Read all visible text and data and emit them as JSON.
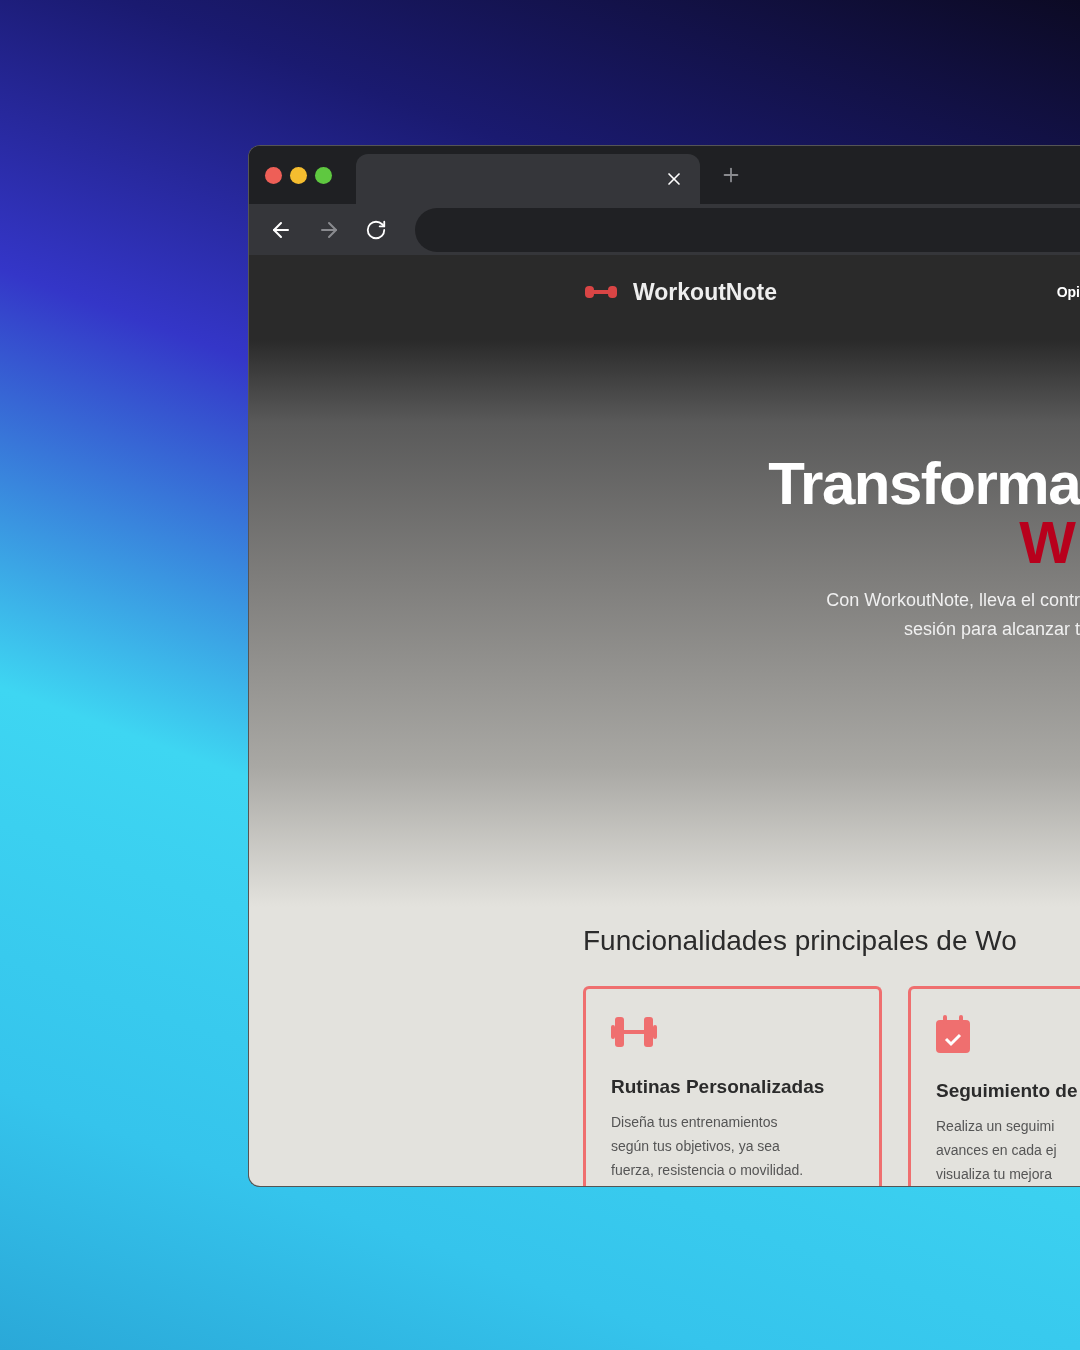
{
  "window_controls": [
    {
      "color": "#ee5f57"
    },
    {
      "color": "#f5bd2f"
    },
    {
      "color": "#5fc840"
    }
  ],
  "nav": {
    "logo": "WorkoutNote",
    "items": [
      "Opi"
    ]
  },
  "hero": {
    "title": "Transforma",
    "highlight": "W",
    "subtitle_lines": [
      "Con WorkoutNote, lleva el contr",
      "sesión para alcanzar t"
    ]
  },
  "features": {
    "title": "Funcionalidades principales de Wo",
    "cards": [
      {
        "kind": "dumbbell",
        "title": "Rutinas Personalizadas",
        "body_lines": [
          "Diseña tus entrenamientos",
          "según tus objetivos, ya sea",
          "fuerza, resistencia o movilidad."
        ]
      },
      {
        "kind": "calendar",
        "title": "Seguimiento de",
        "body_lines": [
          "Realiza un seguimi",
          "avances en cada ej",
          "visualiza tu mejora"
        ]
      }
    ]
  }
}
